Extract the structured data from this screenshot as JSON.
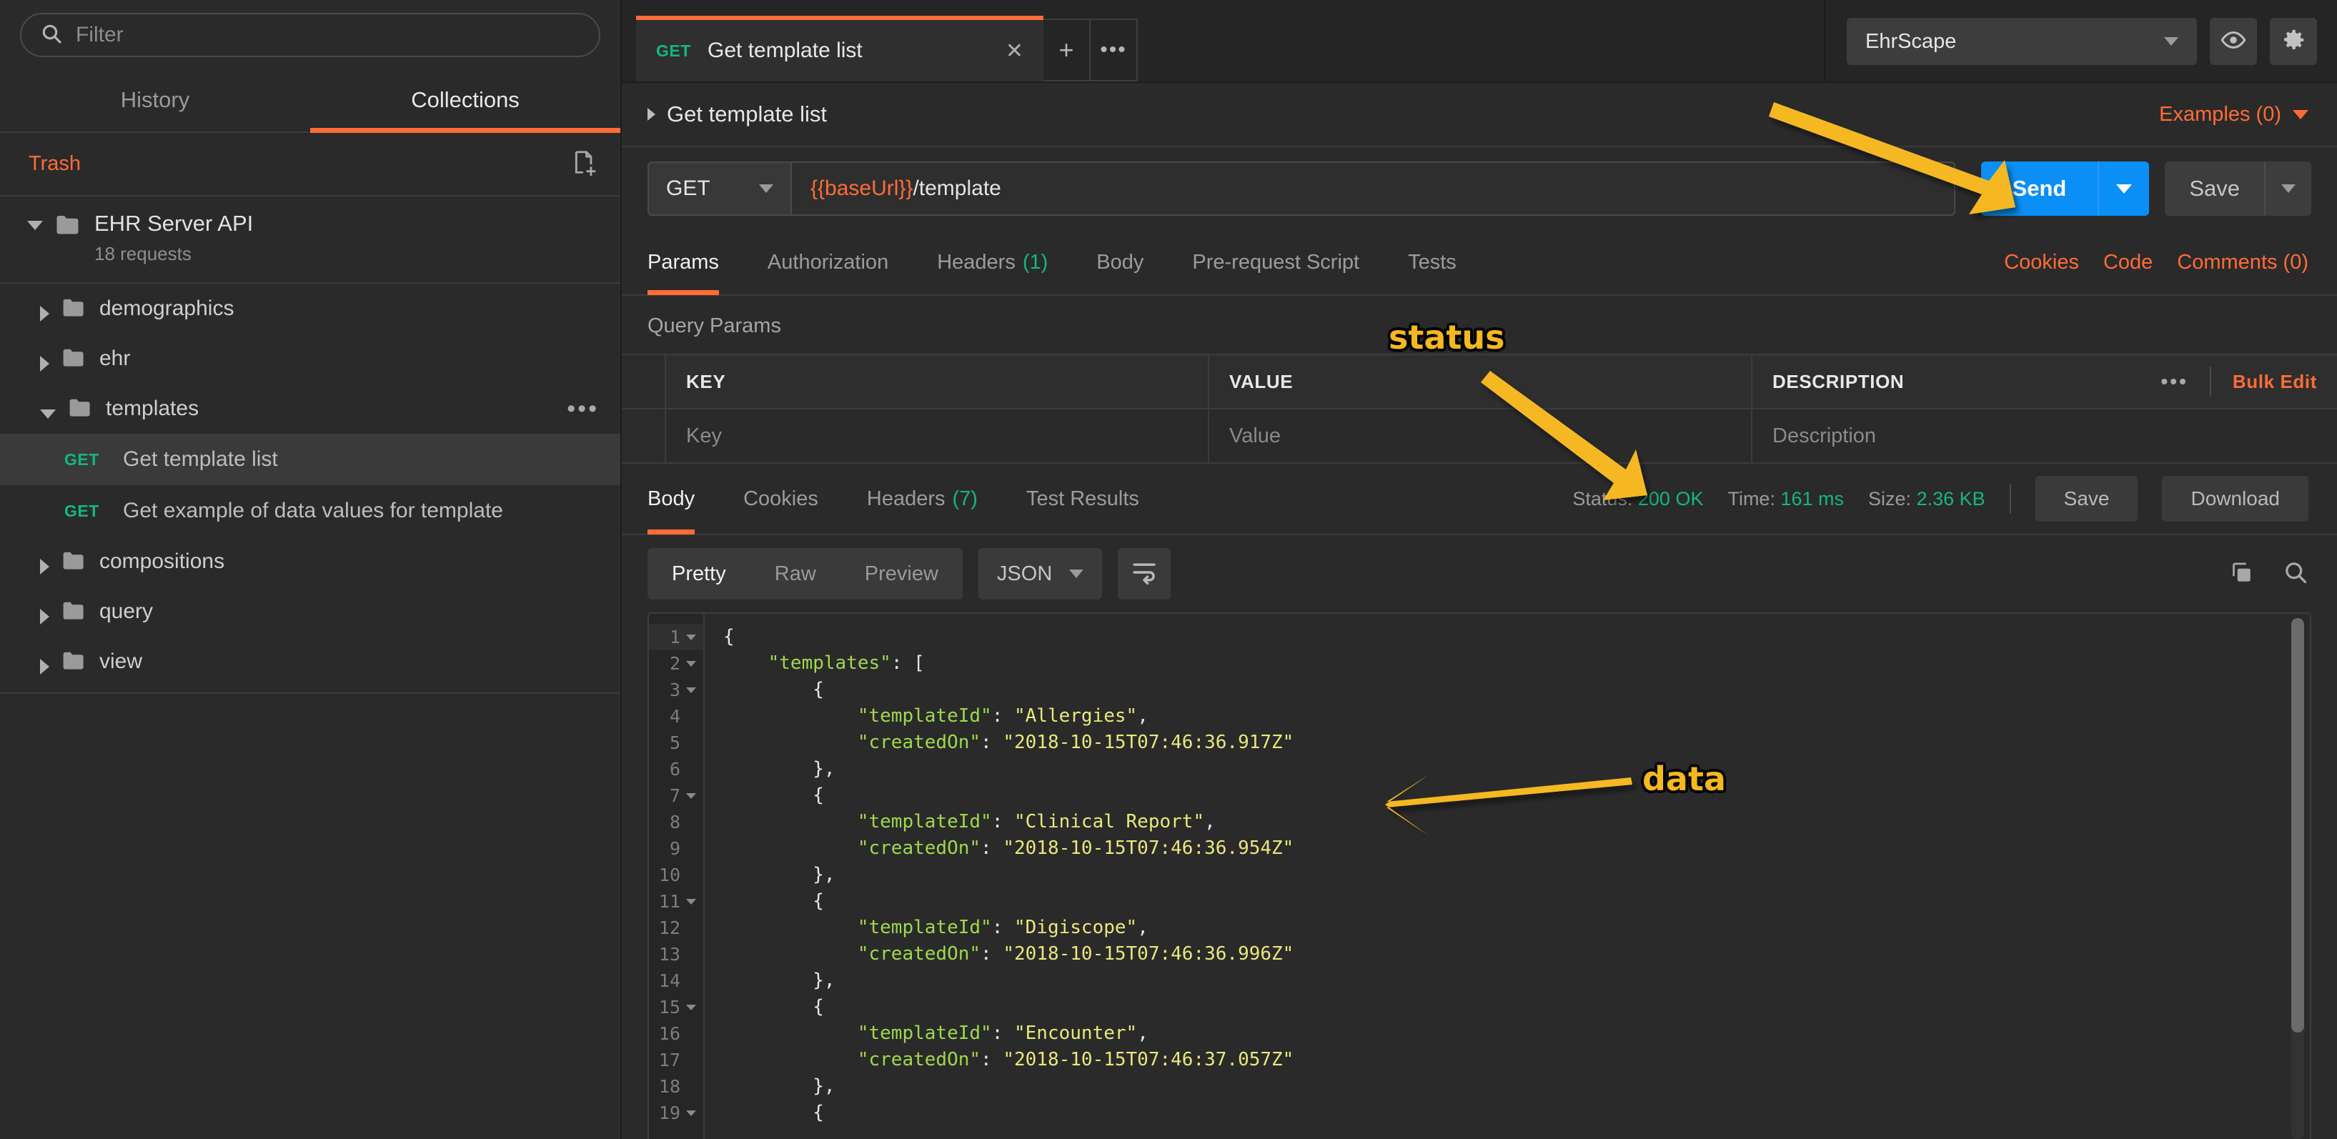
{
  "sidebar": {
    "search": {
      "placeholder": "Filter",
      "value": ""
    },
    "tabs": [
      {
        "label": "History",
        "active": false
      },
      {
        "label": "Collections",
        "active": true
      }
    ],
    "trash_label": "Trash",
    "collection": {
      "title": "EHR Server API",
      "subtitle": "18 requests"
    },
    "tree": [
      {
        "type": "folder",
        "label": "demographics",
        "expanded": false
      },
      {
        "type": "folder",
        "label": "ehr",
        "expanded": false
      },
      {
        "type": "folder",
        "label": "templates",
        "expanded": true,
        "has_more": true
      },
      {
        "type": "request",
        "method": "GET",
        "label": "Get template list",
        "selected": true
      },
      {
        "type": "request",
        "method": "GET",
        "label": "Get example of data values for template",
        "selected": false
      },
      {
        "type": "folder",
        "label": "compositions",
        "expanded": false
      },
      {
        "type": "folder",
        "label": "query",
        "expanded": false
      },
      {
        "type": "folder",
        "label": "view",
        "expanded": false
      }
    ]
  },
  "tabbar": {
    "tabs": [
      {
        "method": "GET",
        "title": "Get template list",
        "close": "✕",
        "active": true
      }
    ],
    "new_tab": "+",
    "more": "•••",
    "environment": {
      "value": "EhrScape"
    }
  },
  "request": {
    "title": "Get template list",
    "examples_label": "Examples (0)",
    "method": "GET",
    "url_variable": "{{baseUrl}}",
    "url_rest": "/template",
    "send_label": "Send",
    "save_label": "Save",
    "tabs": [
      {
        "label": "Params",
        "badge": "",
        "active": true
      },
      {
        "label": "Authorization",
        "badge": "",
        "active": false
      },
      {
        "label": "Headers",
        "badge": "(1)",
        "active": false
      },
      {
        "label": "Body",
        "badge": "",
        "active": false
      },
      {
        "label": "Pre-request Script",
        "badge": "",
        "active": false
      },
      {
        "label": "Tests",
        "badge": "",
        "active": false
      }
    ],
    "right_links": [
      "Cookies",
      "Code",
      "Comments (0)"
    ]
  },
  "query_params": {
    "section_title": "Query Params",
    "columns": [
      "KEY",
      "VALUE",
      "DESCRIPTION"
    ],
    "more": "•••",
    "bulk_edit": "Bulk Edit",
    "placeholder_row": {
      "key": "Key",
      "value": "Value",
      "description": "Description"
    }
  },
  "response": {
    "tabs": [
      {
        "label": "Body",
        "badge": "",
        "active": true
      },
      {
        "label": "Cookies",
        "badge": "",
        "active": false
      },
      {
        "label": "Headers",
        "badge": "(7)",
        "active": false
      },
      {
        "label": "Test Results",
        "badge": "",
        "active": false
      }
    ],
    "status_label": "Status:",
    "status_value": "200 OK",
    "time_label": "Time:",
    "time_value": "161 ms",
    "size_label": "Size:",
    "size_value": "2.36 KB",
    "save_label": "Save",
    "download_label": "Download",
    "view_modes": [
      {
        "label": "Pretty",
        "active": true
      },
      {
        "label": "Raw",
        "active": false
      },
      {
        "label": "Preview",
        "active": false
      }
    ],
    "format": "JSON",
    "body_lines": [
      {
        "n": "1",
        "fold": true,
        "text": "{"
      },
      {
        "n": "2",
        "fold": true,
        "text": "    \"templates\": ["
      },
      {
        "n": "3",
        "fold": true,
        "text": "        {"
      },
      {
        "n": "4",
        "fold": false,
        "text": "            \"templateId\": \"Allergies\","
      },
      {
        "n": "5",
        "fold": false,
        "text": "            \"createdOn\": \"2018-10-15T07:46:36.917Z\""
      },
      {
        "n": "6",
        "fold": false,
        "text": "        },"
      },
      {
        "n": "7",
        "fold": true,
        "text": "        {"
      },
      {
        "n": "8",
        "fold": false,
        "text": "            \"templateId\": \"Clinical Report\","
      },
      {
        "n": "9",
        "fold": false,
        "text": "            \"createdOn\": \"2018-10-15T07:46:36.954Z\""
      },
      {
        "n": "10",
        "fold": false,
        "text": "        },"
      },
      {
        "n": "11",
        "fold": true,
        "text": "        {"
      },
      {
        "n": "12",
        "fold": false,
        "text": "            \"templateId\": \"Digiscope\","
      },
      {
        "n": "13",
        "fold": false,
        "text": "            \"createdOn\": \"2018-10-15T07:46:36.996Z\""
      },
      {
        "n": "14",
        "fold": false,
        "text": "        },"
      },
      {
        "n": "15",
        "fold": true,
        "text": "        {"
      },
      {
        "n": "16",
        "fold": false,
        "text": "            \"templateId\": \"Encounter\","
      },
      {
        "n": "17",
        "fold": false,
        "text": "            \"createdOn\": \"2018-10-15T07:46:37.057Z\""
      },
      {
        "n": "18",
        "fold": false,
        "text": "        },"
      },
      {
        "n": "19",
        "fold": true,
        "text": "        {"
      }
    ]
  },
  "annotations": [
    {
      "label": "status",
      "color": "#f5b820"
    },
    {
      "label": "data",
      "color": "#f5b820"
    }
  ],
  "colors": {
    "accent_orange": "#ff6c37",
    "send_blue": "#0a8ff7",
    "status_green": "#13b87a",
    "annotation_yellow": "#f5b820",
    "background": "#2a2a2a"
  }
}
